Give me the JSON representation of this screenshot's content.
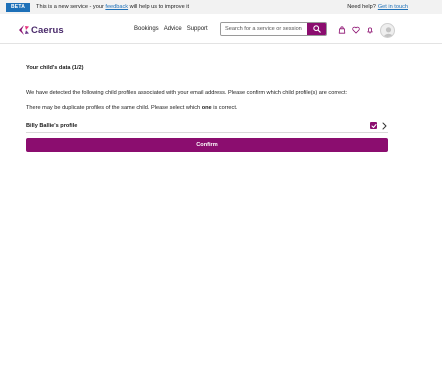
{
  "banner": {
    "tag": "BETA",
    "text_before": "This is a new service - your",
    "feedback_link": "feedback",
    "text_after": "will help us to improve it",
    "help_label": "Need help?",
    "help_link": "Get in touch"
  },
  "header": {
    "brand": "Caerus",
    "nav": [
      "Bookings",
      "Advice",
      "Support"
    ],
    "search_placeholder": "Search for a service or session",
    "accent_color": "#8b0d6f",
    "icons": [
      "bag-icon",
      "heart-icon",
      "bell-icon",
      "user-avatar-icon"
    ]
  },
  "main": {
    "title": "Your child's data (1/2)",
    "intro": "We have detected the following child profiles associated with your email address. Please confirm which child profile(s) are correct:",
    "dup_before": "There may be duplicate profiles of the same child. Please select which",
    "dup_bold": "one",
    "dup_after": "is correct.",
    "profiles": [
      {
        "name": "Billy Ballie's profile",
        "checked": true
      }
    ],
    "confirm_label": "Confirm"
  }
}
